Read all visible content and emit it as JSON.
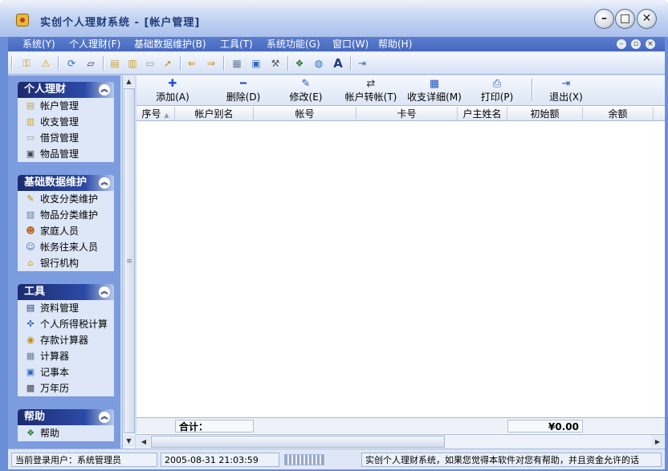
{
  "window": {
    "title": "实创个人理财系统 - [帐户管理]",
    "controls": {
      "minimize": "–",
      "maximize": "□",
      "close": "✕"
    }
  },
  "menubar": {
    "items": [
      "系统(Y)",
      "个人理财(F)",
      "基础数据维护(B)",
      "工具(T)",
      "系统功能(G)",
      "窗口(W)",
      "帮助(H)"
    ]
  },
  "toolbar": {
    "icons": [
      "key-icon",
      "warning-icon",
      "refresh-icon",
      "eraser-icon",
      "folder-icon",
      "clipboard-icon",
      "notes-icon",
      "export-icon",
      "transfer-left-icon",
      "transfer-right-icon",
      "calculator-icon",
      "notebook-icon",
      "hammer-icon",
      "book-icon",
      "globe-icon",
      "font-icon",
      "exit-icon"
    ]
  },
  "sidebar": {
    "groups": [
      {
        "title": "个人理财",
        "items": [
          "帐户管理",
          "收支管理",
          "借贷管理",
          "物品管理"
        ]
      },
      {
        "title": "基础数据维护",
        "items": [
          "收支分类维护",
          "物品分类维护",
          "家庭人员",
          "帐务往来人员",
          "银行机构"
        ]
      },
      {
        "title": "工具",
        "items": [
          "资料管理",
          "个人所得税计算",
          "存款计算器",
          "计算器",
          "记事本",
          "万年历"
        ]
      },
      {
        "title": "帮助",
        "items": [
          "帮助"
        ]
      }
    ]
  },
  "main_toolbar": {
    "buttons": [
      {
        "label": "添加(A)",
        "icon": "plus-icon",
        "glyph": "✚"
      },
      {
        "label": "删除(D)",
        "icon": "minus-icon",
        "glyph": "━"
      },
      {
        "label": "修改(E)",
        "icon": "pen-icon",
        "glyph": "✎"
      },
      {
        "label": "帐户转帐(T)",
        "icon": "transfer-icon",
        "glyph": "⇄"
      },
      {
        "label": "收支详细(M)",
        "icon": "table-icon",
        "glyph": "▦"
      },
      {
        "label": "打印(P)",
        "icon": "printer-icon",
        "glyph": "⎙"
      },
      {
        "label": "退出(X)",
        "icon": "exit-icon",
        "glyph": "⇥"
      }
    ]
  },
  "grid": {
    "columns": [
      "序号",
      "帐户别名",
      "帐号",
      "卡号",
      "户主姓名",
      "初始额",
      "余额"
    ],
    "sort_indicator": "▲",
    "rows": [],
    "footer_label": "合计：",
    "footer_total": "¥0.00"
  },
  "statusbar": {
    "user": "当前登录用户：系统管理员",
    "datetime": "2005-08-31 21:03:59",
    "message": "实创个人理财系统，如果您觉得本软件对您有帮助，并且资金允许的话"
  },
  "colors": {
    "title_accent": "#1f3b7a",
    "menubar": "#4668be",
    "sidebar_header": "#1b2b6e"
  }
}
